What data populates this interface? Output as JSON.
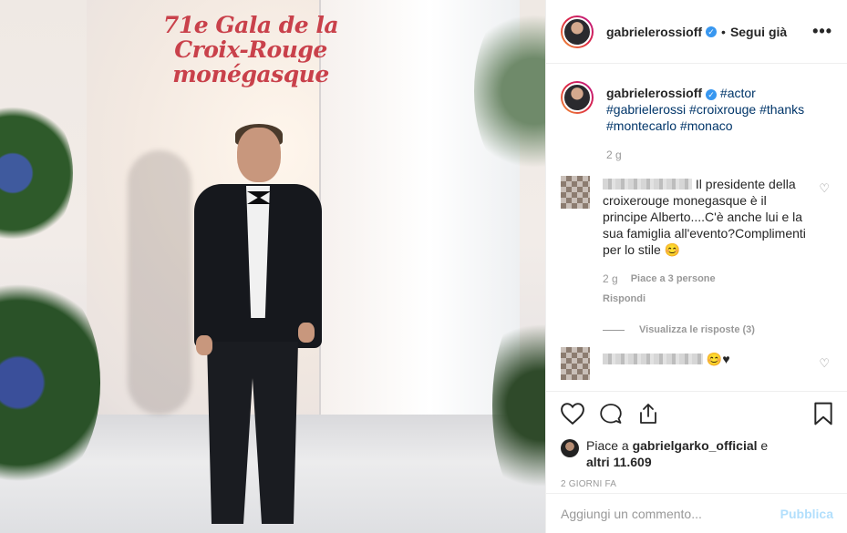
{
  "photo": {
    "banner_text": [
      "71e Gala de la",
      "Croix-Rouge",
      "monégasque"
    ]
  },
  "header": {
    "username": "gabrielerossioff",
    "separator": "•",
    "follow_label": "Segui già",
    "more_label": "•••"
  },
  "caption": {
    "username": "gabrielerossioff",
    "hashtags": "#actor #gabrielerossi #croixrouge #thanks #montecarlo #monaco",
    "time": "2 g"
  },
  "comment1": {
    "text": "Il presidente della croixerouge monegasque è il principe Alberto....C'è anche lui e la sua famiglia all'evento?Complimenti per lo stile 😊",
    "time": "2 g",
    "likes": "Piace a 3 persone",
    "reply_label": "Rispondi",
    "view_replies": "Visualizza le risposte (3)"
  },
  "comment2": {
    "text": "😊♥"
  },
  "likes": {
    "prefix": "Piace a",
    "user": "gabrielgarko_official",
    "conj": "e",
    "others": "altri 11.609"
  },
  "timestamp": "2 GIORNI FA",
  "add_comment": {
    "placeholder": "Aggiungi un commento...",
    "publish_label": "Pubblica"
  },
  "colors": {
    "link": "#003569",
    "verified": "#3897f0",
    "publish": "#b2dffc",
    "banner": "#c9414b"
  }
}
